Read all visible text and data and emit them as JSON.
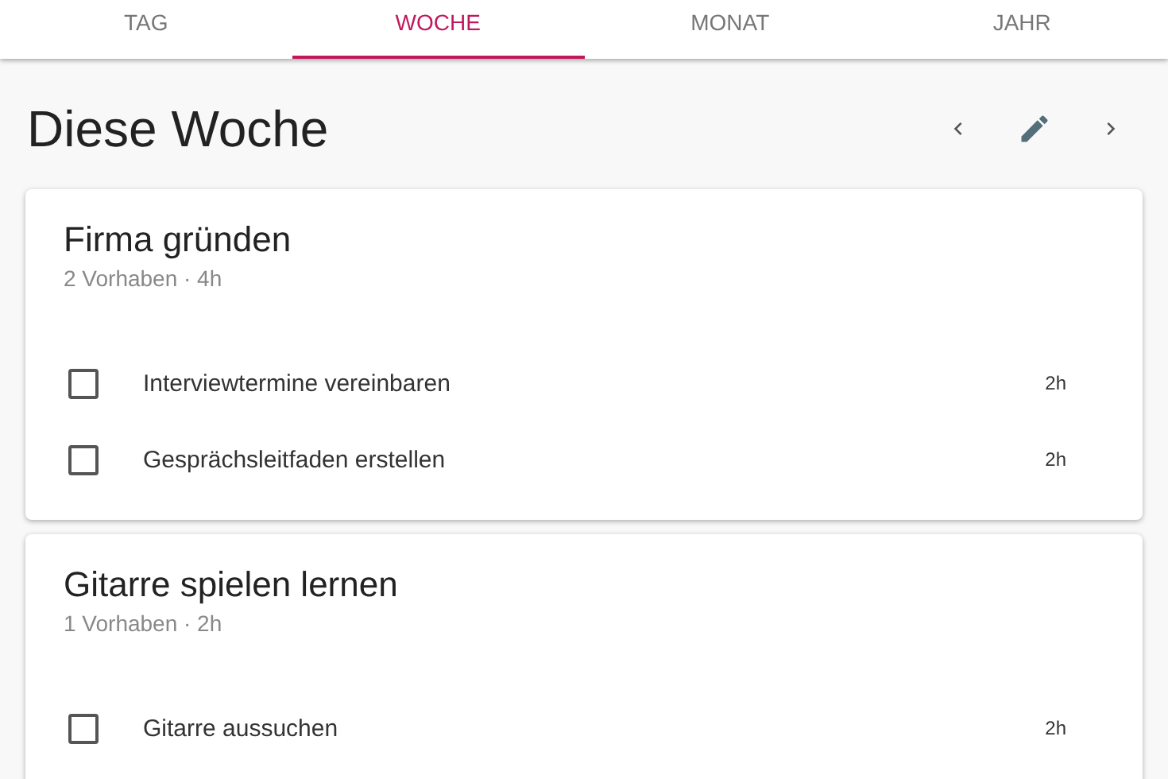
{
  "tabs": [
    {
      "label": "TAG",
      "selected": false
    },
    {
      "label": "WOCHE",
      "selected": true
    },
    {
      "label": "MONAT",
      "selected": false
    },
    {
      "label": "JAHR",
      "selected": false
    }
  ],
  "page_title": "Diese Woche",
  "goals": [
    {
      "title": "Firma gründen",
      "summary": "2 Vorhaben · 4h",
      "tasks": [
        {
          "label": "Interviewtermine vereinbaren",
          "duration": "2h",
          "checked": false
        },
        {
          "label": "Gesprächsleitfaden erstellen",
          "duration": "2h",
          "checked": false
        }
      ]
    },
    {
      "title": "Gitarre spielen lernen",
      "summary": "1 Vorhaben · 2h",
      "tasks": [
        {
          "label": "Gitarre aussuchen",
          "duration": "2h",
          "checked": false
        }
      ]
    }
  ]
}
